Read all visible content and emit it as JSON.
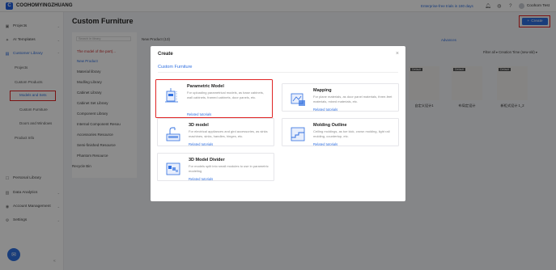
{
  "app": {
    "brand": "COOHOMYINGZHUANG",
    "logo_letter": "C",
    "promo": "Enterprise-free trials in 180 days",
    "user_name": "Coohom Test"
  },
  "sidebar": {
    "items": [
      {
        "label": "Projects",
        "icon": "folder-icon",
        "glyph": "▣"
      },
      {
        "label": "AI Templates",
        "icon": "ai-icon",
        "glyph": "✦"
      },
      {
        "label": "Customer Library",
        "icon": "library-icon",
        "glyph": "▤"
      },
      {
        "label": "Personal Library",
        "icon": "user-library-icon",
        "glyph": "☐"
      },
      {
        "label": "Data Analytics",
        "icon": "chart-icon",
        "glyph": "▥"
      },
      {
        "label": "Account Management",
        "icon": "account-icon",
        "glyph": "◉"
      },
      {
        "label": "Settings",
        "icon": "gear-icon",
        "glyph": "⚙"
      }
    ],
    "sub": {
      "projects": "Projects",
      "custom_products": "Custom Products",
      "models_and_sets": "Models and Sets",
      "custom_furniture": "Custom Furniture",
      "doors_windows": "Doors and Windows",
      "product_info": "Product Info"
    }
  },
  "main": {
    "title": "Custom Furniture",
    "create_label": "Create",
    "create_icon": "+",
    "search_placeholder": "Search in library",
    "panel_items": [
      "The model of the part(...",
      "New Product",
      "Material library",
      "Modling Library",
      "Cabinet Library",
      "Cabinet Set Library",
      "Component Library",
      "Internal Component Resou",
      "Accessories Resource",
      "Semi-finished Resource",
      "Phantom Resource"
    ],
    "recycle_bin": "Recycle Bin",
    "content_head": "New Product (13)",
    "advanced": "Advances",
    "filters": "Filter all  ▾    Creation Time (new-old)  ▾",
    "thumbs": [
      {
        "tag": "Default",
        "caption": "自定义设计1"
      },
      {
        "tag": "Default",
        "caption": "布局定设计"
      },
      {
        "tag": "Default",
        "caption": "新柜式设计 1_2"
      }
    ]
  },
  "modal": {
    "title": "Create",
    "close_glyph": "×",
    "tab": "Custom Furniture",
    "cards": [
      {
        "title": "Parametric Model",
        "desc": "For uploading parametrical models, as base cabinets, wall cabinets, framed cabinets, door panels, etc.",
        "tutorial": "Related tutorials",
        "icon": "parametric-model-icon"
      },
      {
        "title": "Mapping",
        "desc": "For plane materials, as door panel materials, three-feet materials, mixed materials, etc.",
        "tutorial": "Related tutorials",
        "icon": "mapping-icon"
      },
      {
        "title": "3D model",
        "desc": "For electrical appliances and gird accessories, as sinks machines, sinks, handles, hinges, etc.",
        "tutorial": "Related tutorials",
        "icon": "3d-model-icon"
      },
      {
        "title": "Molding Outline",
        "desc": "Ceiling moldings, as toe kick, crown molding, light rail molding, countertop, etc.",
        "tutorial": "Related tutorials",
        "icon": "molding-outline-icon"
      },
      {
        "title": "3D Model Divider",
        "desc": "For models split into small modules to use in parametric modeling",
        "tutorial": "Related tutorials",
        "icon": "model-divider-icon"
      }
    ]
  },
  "colors": {
    "accent": "#2f6fe0",
    "highlight": "#e02424"
  }
}
